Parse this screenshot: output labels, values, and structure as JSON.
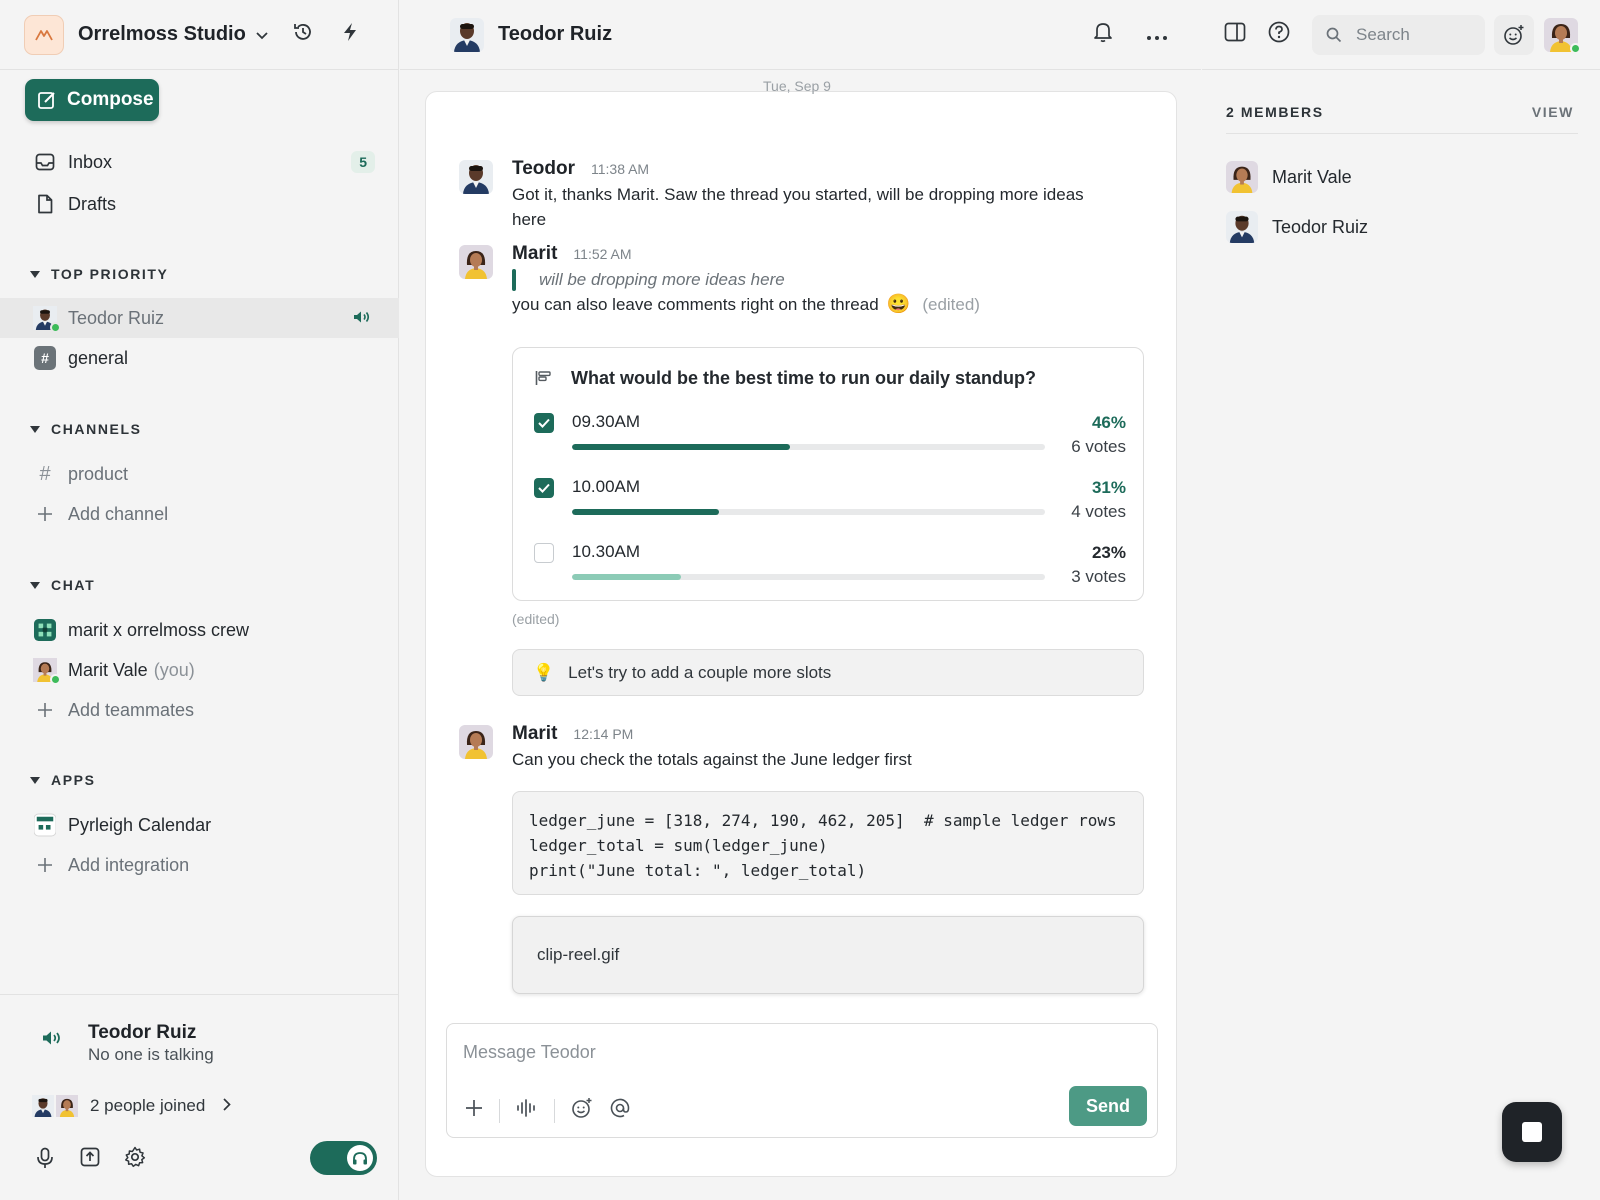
{
  "workspace": {
    "name": "Orrelmoss Studio"
  },
  "compose": {
    "label": "Compose"
  },
  "nav": {
    "inbox": {
      "label": "Inbox",
      "badge": "5"
    },
    "drafts": {
      "label": "Drafts"
    }
  },
  "sections": {
    "top_priority": {
      "title": "TOP PRIORITY",
      "items": [
        {
          "label": "Teodor Ruiz"
        },
        {
          "label": "general"
        }
      ]
    },
    "channels": {
      "title": "CHANNELS",
      "items": [
        {
          "label": "product"
        },
        {
          "label": "Add channel"
        }
      ]
    },
    "chat": {
      "title": "CHAT",
      "items": [
        {
          "label": "marit x orrelmoss crew"
        },
        {
          "label": "Marit Vale",
          "suffix": "(you)"
        },
        {
          "label": "Add teammates"
        }
      ]
    },
    "apps": {
      "title": "APPS",
      "items": [
        {
          "label": "Pyrleigh Calendar"
        },
        {
          "label": "Add integration"
        }
      ]
    }
  },
  "voice": {
    "name": "Teodor Ruiz",
    "status": "No one is talking",
    "joined": "2 people joined"
  },
  "conversation": {
    "title": "Teodor Ruiz",
    "date_divider": "Tue, Sep 9",
    "messages": [
      {
        "author": "Teodor",
        "time": "11:38 AM",
        "text_line1": "Got it, thanks Marit. Saw the thread you started, will be dropping more ideas",
        "text_line2": "here"
      },
      {
        "author": "Marit",
        "time": "11:52 AM",
        "quote": "will be dropping more ideas here",
        "text": "you can also leave comments right on the thread",
        "emoji": "😀",
        "edited": "(edited)"
      },
      {
        "author": "Marit",
        "time": "12:14 PM",
        "text": "Can you check the totals against the June ledger first"
      }
    ],
    "poll": {
      "question": "What would be the best time to run our daily standup?",
      "options": [
        {
          "label": "09.30AM",
          "percent_label": "46%",
          "votes_label": "6 votes",
          "fraction": 0.46,
          "checked": true
        },
        {
          "label": "10.00AM",
          "percent_label": "31%",
          "votes_label": "4 votes",
          "fraction": 0.31,
          "checked": true
        },
        {
          "label": "10.30AM",
          "percent_label": "23%",
          "votes_label": "3 votes",
          "fraction": 0.23,
          "checked": false
        }
      ],
      "edited": "(edited)"
    },
    "hint": {
      "emoji": "💡",
      "text": "Let's try to add a couple more slots"
    },
    "code_lines": [
      "ledger_june = [318, 274, 190, 462, 205]  # sample ledger rows",
      "ledger_total = sum(ledger_june)",
      "print(\"June total: \", ledger_total)"
    ],
    "attachment": {
      "filename": "clip-reel.gif"
    },
    "composer": {
      "placeholder": "Message Teodor",
      "send_label": "Send"
    }
  },
  "right_panel": {
    "search_placeholder": "Search",
    "members_title": "2 MEMBERS",
    "view_label": "VIEW",
    "members": [
      {
        "name": "Marit Vale"
      },
      {
        "name": "Teodor Ruiz"
      }
    ]
  },
  "colors": {
    "accent": "#1d6b5a",
    "accent_light": "#8ccbb6",
    "send": "#4d9a85",
    "online": "#3dbb5a"
  }
}
